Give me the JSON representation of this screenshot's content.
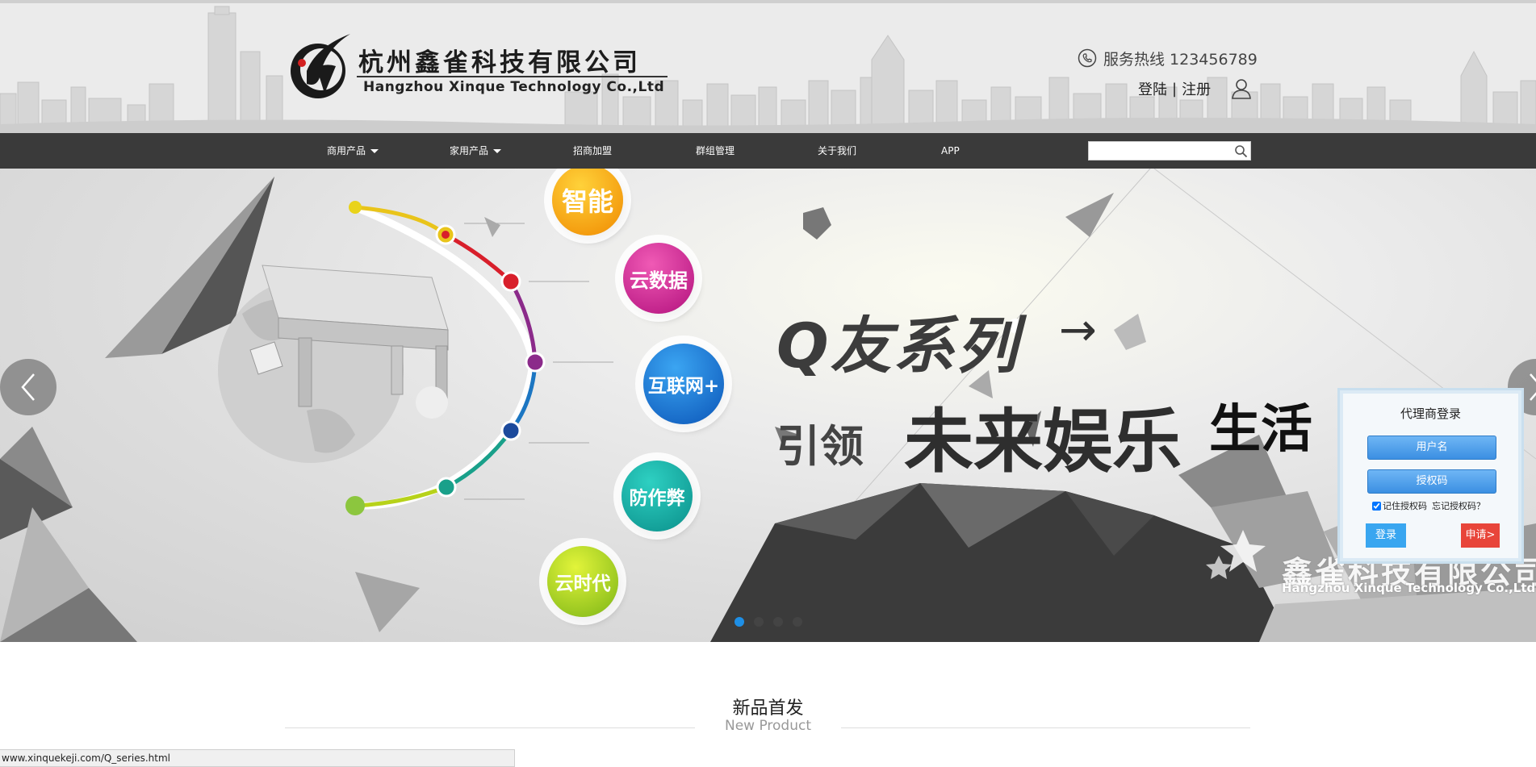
{
  "header": {
    "logo_cn": "杭州鑫雀科技有限公司",
    "logo_en": "Hangzhou Xinque Technology Co.,Ltd",
    "hotline": "服务热线 123456789",
    "login": "登陆",
    "separator": "|",
    "register": "注册"
  },
  "nav": {
    "items": [
      {
        "label": "商用产品",
        "dropdown": true
      },
      {
        "label": "家用产品",
        "dropdown": true
      },
      {
        "label": "招商加盟",
        "dropdown": false
      },
      {
        "label": "群组管理",
        "dropdown": false
      },
      {
        "label": "关于我们",
        "dropdown": false
      },
      {
        "label": "APP",
        "dropdown": false
      }
    ],
    "search_value": ""
  },
  "banner": {
    "bubbles": [
      "智能",
      "云数据",
      "互联网+",
      "防作弊",
      "云时代"
    ],
    "slogan_1": "Q友系列",
    "slogan_arrow": "→",
    "slogan_2a": "引领",
    "slogan_2b": "未来娱乐",
    "slogan_2c": "生活",
    "watermark_cn": "鑫雀科技有限公司",
    "watermark_en": "Hangzhou Xinque Technology Co.,Ltd",
    "slide_count": 4,
    "active_slide": 1
  },
  "agent_login": {
    "title": "代理商登录",
    "username_placeholder": "用户名",
    "code_placeholder": "授权码",
    "remember": "记住授权码",
    "forgot": "忘记授权码？",
    "remember_checked": true,
    "login_button": "登录",
    "apply_button": "申请>"
  },
  "new_product": {
    "title": "新品首发",
    "subtitle": "New Product"
  },
  "status_bar": {
    "url": "www.xinquekeji.com/Q_series.html"
  },
  "colors": {
    "nav_bg": "#3a3a3a",
    "accent_blue": "#39a6f0",
    "apply_red": "#e8453a",
    "dot_active": "#1e8fe6"
  }
}
